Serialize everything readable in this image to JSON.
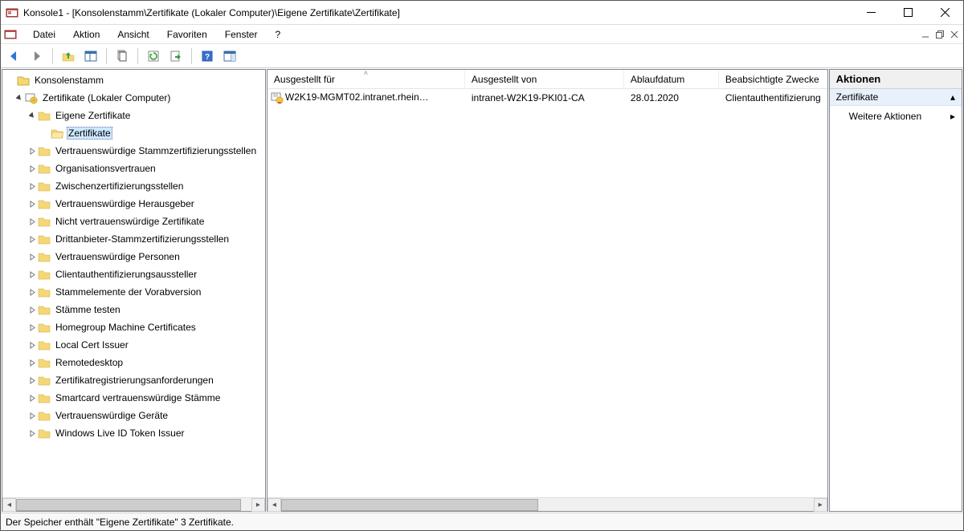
{
  "window": {
    "title": "Konsole1 - [Konsolenstamm\\Zertifikate (Lokaler Computer)\\Eigene Zertifikate\\Zertifikate]"
  },
  "menu": {
    "datei": "Datei",
    "aktion": "Aktion",
    "ansicht": "Ansicht",
    "favoriten": "Favoriten",
    "fenster": "Fenster",
    "help": "?"
  },
  "tree": {
    "root": "Konsolenstamm",
    "snap": "Zertifikate (Lokaler Computer)",
    "selected_parent": "Eigene Zertifikate",
    "selected": "Zertifikate",
    "items": [
      "Vertrauenswürdige Stammzertifizierungsstellen",
      "Organisationsvertrauen",
      "Zwischenzertifizierungsstellen",
      "Vertrauenswürdige Herausgeber",
      "Nicht vertrauenswürdige Zertifikate",
      "Drittanbieter-Stammzertifizierungsstellen",
      "Vertrauenswürdige Personen",
      "Clientauthentifizierungsaussteller",
      "Stammelemente der Vorabversion",
      "Stämme testen",
      "Homegroup Machine Certificates",
      "Local Cert Issuer",
      "Remotedesktop",
      "Zertifikatregistrierungsanforderungen",
      "Smartcard vertrauenswürdige Stämme",
      "Vertrauenswürdige Geräte",
      "Windows Live ID Token Issuer"
    ]
  },
  "columns": {
    "c0": "Ausgestellt für",
    "c1": "Ausgestellt von",
    "c2": "Ablaufdatum",
    "c3": "Beabsichtigte Zwecke"
  },
  "row": {
    "issued_to": "W2K19-MGMT02.intranet.rhein…",
    "issued_by": "intranet-W2K19-PKI01-CA",
    "expires": "28.01.2020",
    "purpose": "Clientauthentifizierung"
  },
  "actions": {
    "header": "Aktionen",
    "sub": "Zertifikate",
    "more": "Weitere Aktionen"
  },
  "status": "Der Speicher enthält \"Eigene Zertifikate\" 3 Zertifikate."
}
